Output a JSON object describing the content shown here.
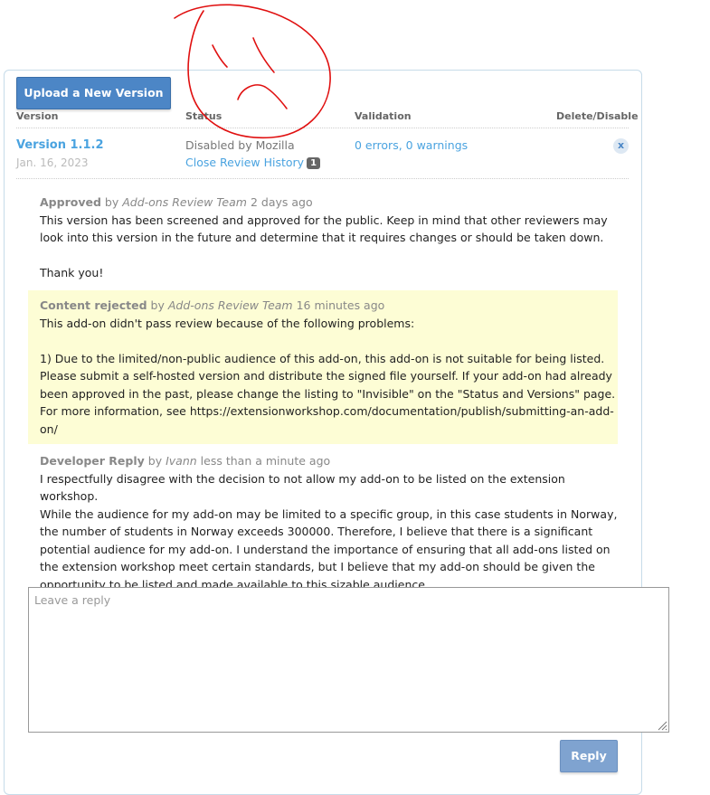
{
  "toolbar": {
    "upload_label": "Upload a New Version"
  },
  "table": {
    "columns": [
      "Version",
      "Status",
      "Validation",
      "Delete/Disable"
    ],
    "row": {
      "version": "Version 1.1.2",
      "date": "Jan. 16, 2023",
      "status": "Disabled by Mozilla",
      "history_link": "Close Review History",
      "history_count": "1",
      "validation": "0 errors, 0 warnings",
      "delete_label": "x"
    }
  },
  "history": [
    {
      "action": "Approved",
      "by_word": "by",
      "author": "Add-ons Review Team",
      "time": "2 days ago",
      "body": [
        "This version has been screened and approved for the public. Keep in mind that other reviewers may",
        "look into this version in the future and determine that it requires changes or should be taken down.",
        "",
        "Thank you!"
      ]
    },
    {
      "action": "Content rejected",
      "by_word": "by",
      "author": "Add-ons Review Team",
      "time": "16 minutes ago",
      "body": [
        "This add-on didn't pass review because of the following problems:",
        "",
        "1) Due to the limited/non-public audience of this add-on, this add-on is not suitable for being listed.",
        "Please submit a self-hosted version and distribute the signed file yourself. If your add-on had already",
        "been approved in the past, please change the listing to \"Invisible\" on the \"Status and Versions\" page.",
        "For more information, see https://extensionworkshop.com/documentation/publish/submitting-an-add-",
        "on/"
      ]
    },
    {
      "action": "Developer Reply",
      "by_word": "by",
      "author": "Ivann",
      "time": "less than a minute ago",
      "body": [
        "I respectfully disagree with the decision to not allow my add-on to be listed on the extension workshop.",
        "While the audience for my add-on may be limited to a specific group, in this case students in Norway,",
        "the number of students in Norway exceeds 300000. Therefore, I believe that there is a significant",
        "potential audience for my add-on. I understand the importance of ensuring that all add-ons listed on",
        "the extension workshop meet certain standards, but I believe that my add-on should be given the",
        "opportunity to be listed and made available to this sizable audience."
      ]
    }
  ],
  "reply": {
    "placeholder": "Leave a reply",
    "button_label": "Reply"
  },
  "colors": {
    "accent": "#4c86c6",
    "link": "#4aa3e0",
    "highlight": "#fdfdd5",
    "doodle": "#e01010"
  }
}
